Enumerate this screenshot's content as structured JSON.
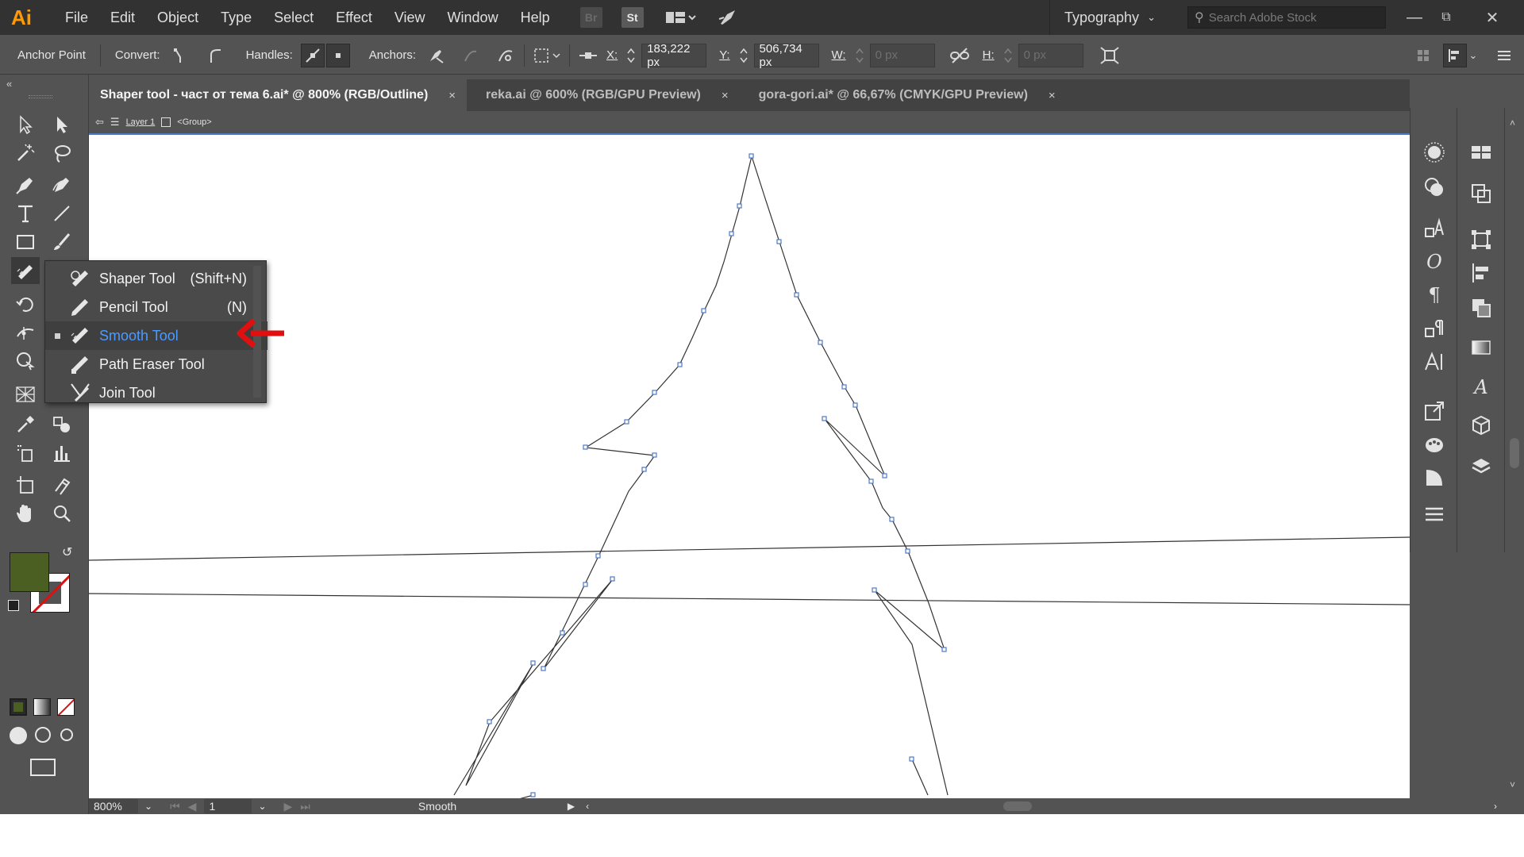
{
  "app": {
    "logo": "Ai"
  },
  "menubar": {
    "items": [
      "File",
      "Edit",
      "Object",
      "Type",
      "Select",
      "Effect",
      "View",
      "Window",
      "Help"
    ],
    "bridge_icon": "Br",
    "stock_icon": "St",
    "workspace": "Typography",
    "search_placeholder": "Search Adobe Stock"
  },
  "controlbar": {
    "tool_name": "Anchor Point",
    "convert_label": "Convert:",
    "handles_label": "Handles:",
    "anchors_label": "Anchors:",
    "x_label": "X:",
    "x_value": "183,222 px",
    "y_label": "Y:",
    "y_value": "506,734 px",
    "w_label": "W:",
    "w_value": "0 px",
    "h_label": "H:",
    "h_value": "0 px"
  },
  "tabs": [
    {
      "label": "Shaper tool - част от тема 6.ai* @ 800% (RGB/Outline)",
      "active": true
    },
    {
      "label": "reka.ai @ 600% (RGB/GPU Preview)",
      "active": false
    },
    {
      "label": "gora-gori.ai* @ 66,67% (CMYK/GPU Preview)",
      "active": false
    }
  ],
  "tab_close": "×",
  "breadcrumb": {
    "layer": "Layer 1",
    "group": "<Group>"
  },
  "flyout": {
    "items": [
      {
        "label": "Shaper Tool",
        "shortcut": "(Shift+N)",
        "icon": "shaper-icon"
      },
      {
        "label": "Pencil Tool",
        "shortcut": "(N)",
        "icon": "pencil-icon"
      },
      {
        "label": "Smooth Tool",
        "shortcut": "",
        "icon": "smooth-icon",
        "current": true
      },
      {
        "label": "Path Eraser Tool",
        "shortcut": "",
        "icon": "path-eraser-icon"
      },
      {
        "label": "Join Tool",
        "shortcut": "",
        "icon": "join-icon"
      }
    ]
  },
  "colors": {
    "fill": "#4b5f22",
    "stroke": "#ffffff",
    "accent_blue": "#4b9bff",
    "arrow_red": "#e01010"
  },
  "statusbar": {
    "zoom": "800%",
    "artboard": "1",
    "current_tool": "Smooth"
  }
}
